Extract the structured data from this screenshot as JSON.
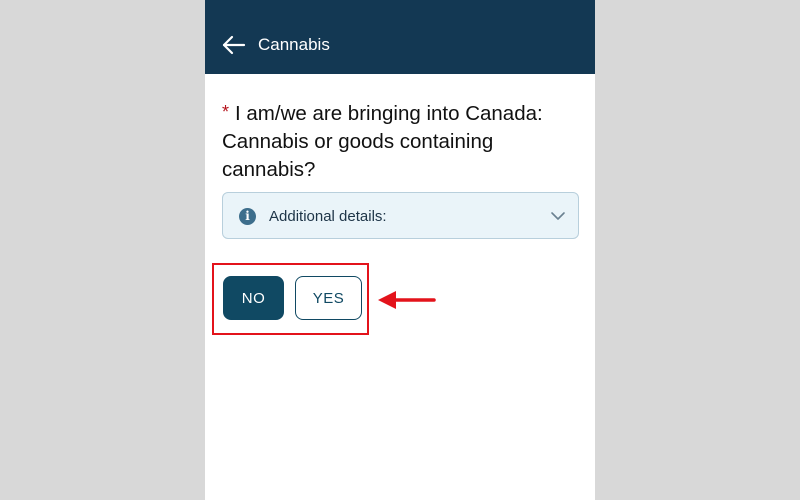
{
  "header": {
    "back_icon": "arrow-left-icon",
    "title": "Cannabis"
  },
  "question": {
    "required_mark": "*",
    "text": "I am/we are bringing into Canada: Cannabis or goods containing cannabis?"
  },
  "details": {
    "icon": "info-icon",
    "icon_glyph": "i",
    "label": "Additional details:",
    "chevron_icon": "chevron-down-icon"
  },
  "answers": {
    "no_label": "NO",
    "yes_label": "YES",
    "selected": "NO"
  },
  "annotation": {
    "color": "#e3131b",
    "arrow_icon": "arrow-left-icon"
  },
  "colors": {
    "header_bg": "#133853",
    "primary": "#104963",
    "details_bg": "#eaf4f9",
    "required": "#b5121b",
    "backdrop": "#d8d8d8"
  }
}
